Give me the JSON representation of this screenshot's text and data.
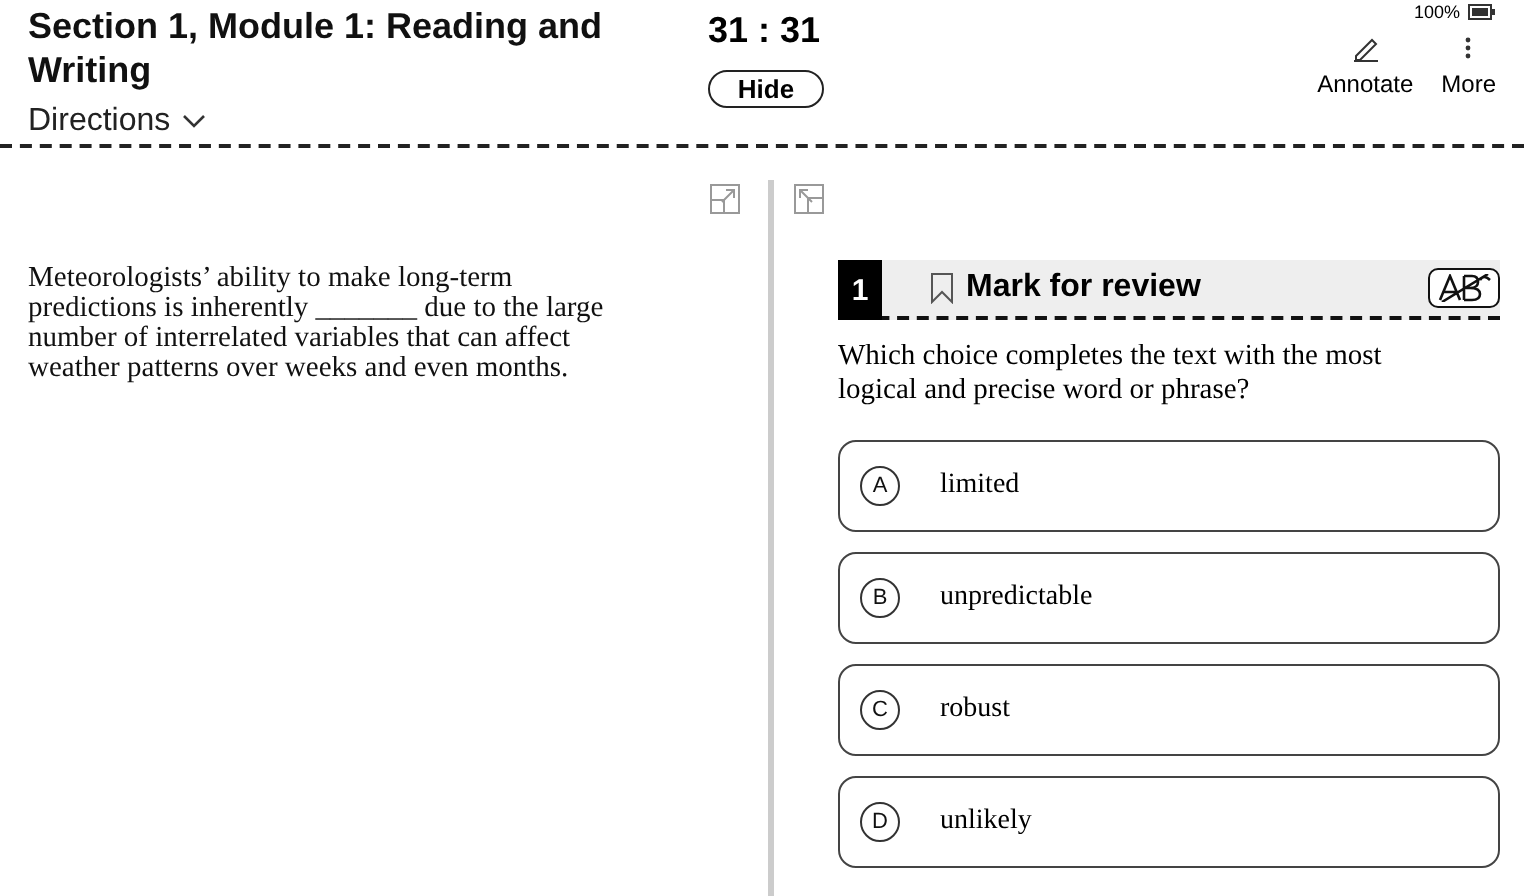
{
  "header": {
    "title": "Section 1, Module 1: Reading and Writing",
    "directions": "Directions",
    "timer": "31 : 31",
    "hide_button": "Hide",
    "battery": "100%",
    "tools": [
      {
        "label": "Annotate",
        "kind": "annotate"
      },
      {
        "label": "More",
        "kind": "more"
      }
    ]
  },
  "passage": {
    "text": "Meteorologists’ ability to make long-term predictions is inherently _______ due to the large number of interrelated variables that can affect weather patterns over weeks and even months."
  },
  "question": {
    "number": "1",
    "mark_for_review": "Mark for review",
    "marked": false,
    "prompt": "Which choice completes the text with the most logical and precise word or phrase?",
    "options": [
      {
        "letter": "A",
        "text": "limited",
        "selected": false
      },
      {
        "letter": "B",
        "text": "unpredictable",
        "selected": false
      },
      {
        "letter": "C",
        "text": "robust",
        "selected": false
      },
      {
        "letter": "D",
        "text": "unlikely",
        "selected": false
      }
    ]
  }
}
